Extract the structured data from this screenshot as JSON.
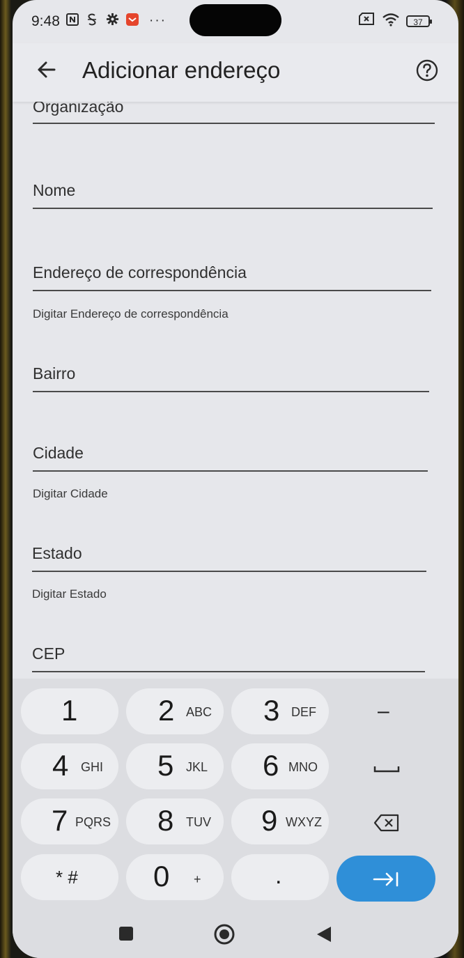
{
  "status_bar": {
    "time": "9:48",
    "icons": [
      "nfc-icon",
      "s-app-icon",
      "gear-icon",
      "notification-app-icon",
      "more-dots-icon"
    ],
    "battery": "37"
  },
  "app_bar": {
    "title": "Adicionar endereço"
  },
  "form": {
    "fields": [
      {
        "label": "Organização",
        "hint": ""
      },
      {
        "label": "Nome",
        "hint": ""
      },
      {
        "label": "Endereço de correspondência",
        "hint": "Digitar Endereço de correspondência"
      },
      {
        "label": "Bairro",
        "hint": ""
      },
      {
        "label": "Cidade",
        "hint": "Digitar Cidade"
      },
      {
        "label": "Estado",
        "hint": "Digitar Estado"
      },
      {
        "label": "CEP",
        "hint": ""
      }
    ]
  },
  "keyboard": {
    "keys": [
      {
        "num": "1",
        "letters": ""
      },
      {
        "num": "2",
        "letters": "ABC"
      },
      {
        "num": "3",
        "letters": "DEF"
      },
      {
        "num": "–",
        "letters": ""
      },
      {
        "num": "4",
        "letters": "GHI"
      },
      {
        "num": "5",
        "letters": "JKL"
      },
      {
        "num": "6",
        "letters": "MNO"
      },
      {
        "num": "␣",
        "letters": ""
      },
      {
        "num": "7",
        "letters": "PQRS"
      },
      {
        "num": "8",
        "letters": "TUV"
      },
      {
        "num": "9",
        "letters": "WXYZ"
      },
      {
        "num": "⌫",
        "letters": ""
      },
      {
        "num": "* #",
        "letters": ""
      },
      {
        "num": "0",
        "letters": "+"
      },
      {
        "num": ".",
        "letters": ""
      },
      {
        "num": "→|",
        "letters": ""
      }
    ],
    "enter_color": "#2f8fd8"
  }
}
